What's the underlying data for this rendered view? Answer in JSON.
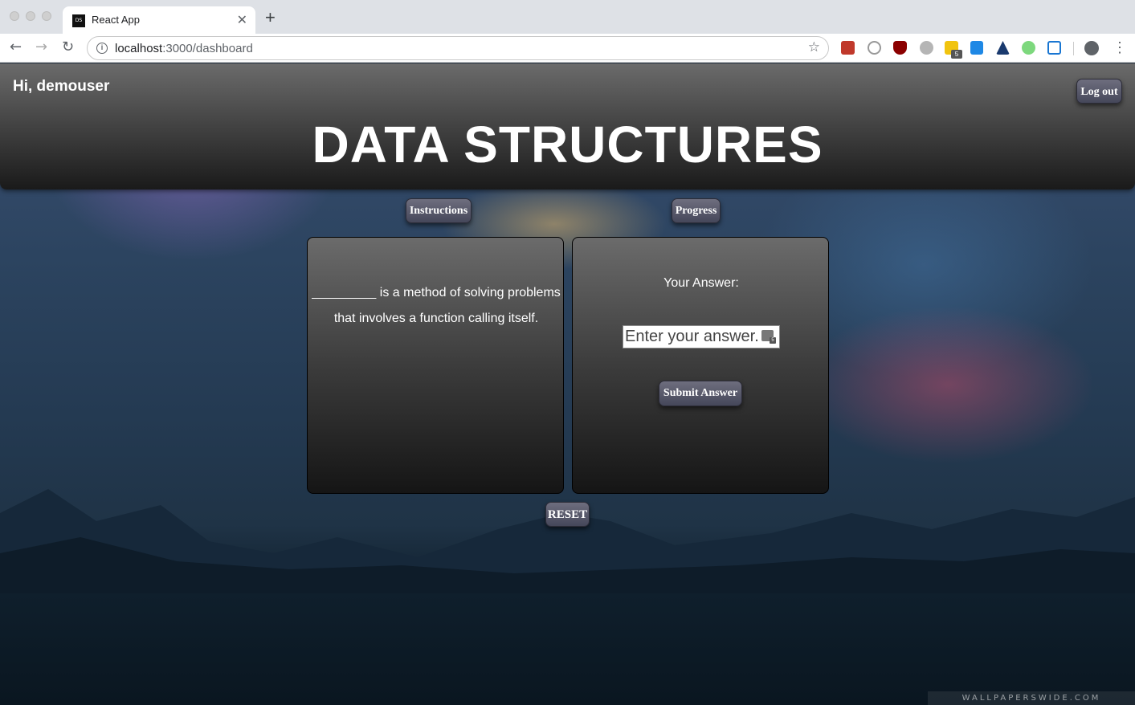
{
  "browser": {
    "tab_title": "React App",
    "tab_favicon_text": "DS",
    "url_host": "localhost",
    "url_path": ":3000/dashboard",
    "extension_badge": "5"
  },
  "header": {
    "greeting": "Hi, demouser",
    "title": "DATA STRUCTURES",
    "logout_label": "Log out"
  },
  "nav": {
    "instructions_label": "Instructions",
    "progress_label": "Progress"
  },
  "question": {
    "text": "_________ is a method of solving problems that involves a function calling itself."
  },
  "answer": {
    "label": "Your Answer:",
    "placeholder": "Enter your answer...",
    "submit_label": "Submit Answer",
    "input_badge": "5"
  },
  "controls": {
    "reset_label": "RESET"
  },
  "background": {
    "watermark": "WALLPAPERSWIDE.COM"
  },
  "colors": {
    "header_top": "#6b6b6b",
    "header_bottom": "#1a1a1a",
    "button_top": "#6e6e7e",
    "button_bottom": "#45475a"
  }
}
